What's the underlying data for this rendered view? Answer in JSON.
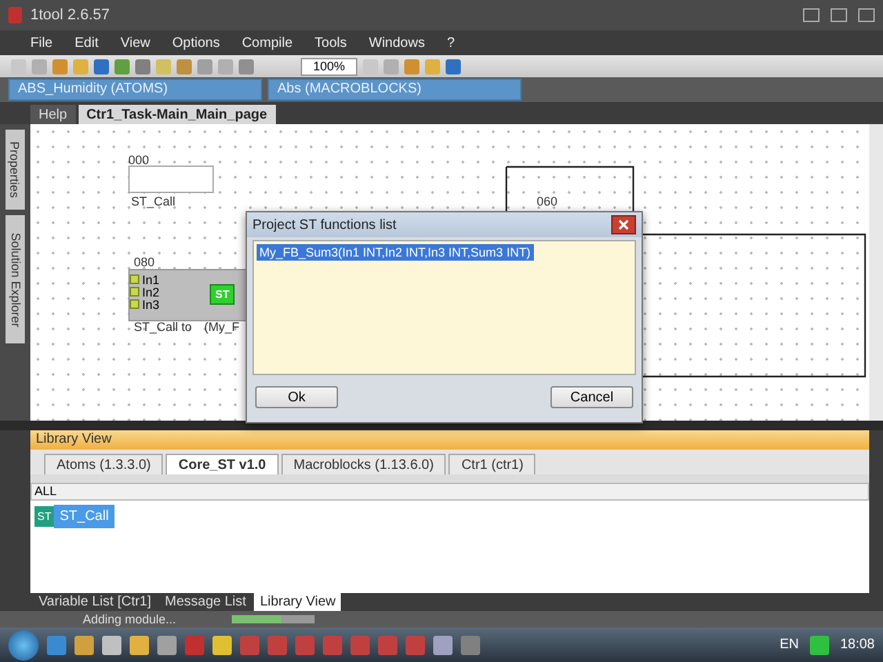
{
  "window": {
    "title": "1tool 2.6.57"
  },
  "menu": [
    "File",
    "Edit",
    "View",
    "Options",
    "Compile",
    "Tools",
    "Windows",
    "?"
  ],
  "toolbar": {
    "zoom": "100%"
  },
  "selectors": [
    "ABS_Humidity (ATOMS)",
    "Abs (MACROBLOCKS)"
  ],
  "side_tabs": [
    "Properties",
    "Solution Explorer"
  ],
  "doc_tabs": [
    {
      "label": "Help",
      "selected": false
    },
    {
      "label": "Ctr1_Task-Main_Main_page",
      "selected": true
    }
  ],
  "canvas": {
    "blocks": [
      {
        "kind": "empty",
        "number": "000",
        "caption": "ST_Call"
      },
      {
        "kind": "function",
        "number": "080",
        "inputs": [
          "In1",
          "In2",
          "In3"
        ],
        "badge": "ST",
        "caption": "ST_Call to",
        "caption_2": "(My_F"
      },
      {
        "kind": "frame",
        "number": "060"
      }
    ]
  },
  "dialog": {
    "title": "Project ST functions list",
    "items": [
      {
        "label": "My_FB_Sum3(In1 INT,In2 INT,In3 INT,Sum3 INT)",
        "selected": true
      }
    ],
    "buttons": [
      "Ok",
      "Cancel"
    ]
  },
  "library": {
    "title": "Library View",
    "tabs": [
      {
        "label": "Atoms (1.3.3.0)",
        "selected": false
      },
      {
        "label": "Core_ST v1.0",
        "selected": true
      },
      {
        "label": "Macroblocks (1.13.6.0)",
        "selected": false
      },
      {
        "label": "Ctr1 (ctr1)",
        "selected": false
      }
    ],
    "filter": "ALL",
    "items": [
      {
        "badge": "ST",
        "label": "ST_Call",
        "selected": true
      }
    ]
  },
  "bottom_tabs": [
    {
      "label": "Variable List [Ctr1]",
      "selected": false
    },
    {
      "label": "Message List",
      "selected": false
    },
    {
      "label": "Library View",
      "selected": true
    }
  ],
  "status": {
    "text": "Adding module...",
    "level": 0.6
  },
  "taskbar": {
    "language": "EN",
    "time": "18:08"
  }
}
